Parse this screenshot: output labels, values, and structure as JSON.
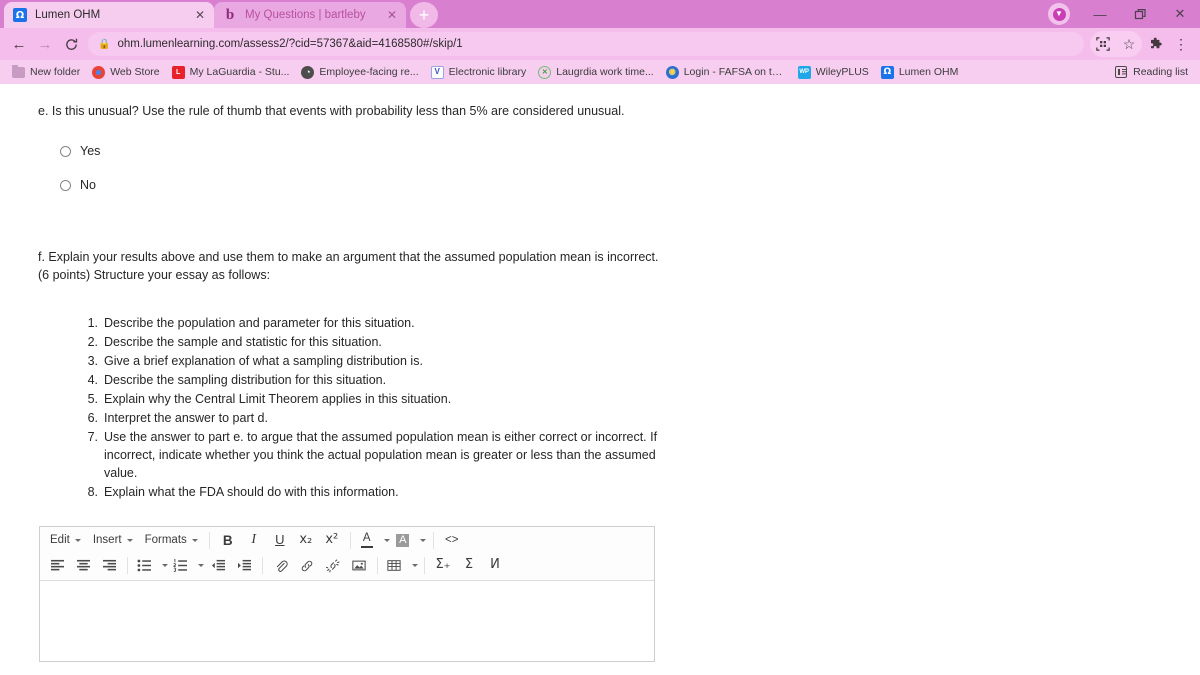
{
  "browser": {
    "tabs": [
      {
        "title": "Lumen OHM",
        "favicon": "omega-icon",
        "active": true,
        "close": "✕"
      },
      {
        "title": "My Questions | bartleby",
        "favicon": "bartleby-b-icon",
        "active": false,
        "close": "✕"
      }
    ],
    "new_tab_label": "+",
    "window_controls": {
      "minimize": "—",
      "maximize": "❐",
      "close": "✕"
    },
    "nav": {
      "back": "←",
      "forward": "→",
      "reload": "⟳"
    },
    "omnibox": {
      "lock": "🔒",
      "host": "ohm.lumenlearning.com",
      "path": "/assess2/?cid=57367&aid=4168580#/skip/1",
      "full_url": "ohm.lumenlearning.com/assess2/?cid=57367&aid=4168580#/skip/1"
    },
    "toolbar_icons": {
      "qr_share": "qr-code-icon",
      "bookmark_star": "☆",
      "extensions": "puzzle-icon",
      "menu": "⋮"
    },
    "bookmarks": [
      {
        "label": "New folder",
        "icon": "folder-icon"
      },
      {
        "label": "Web Store",
        "icon": "chrome-webstore-icon"
      },
      {
        "label": "My LaGuardia - Stu...",
        "icon": "laguardia-icon",
        "glyph": "L"
      },
      {
        "label": "Employee-facing re...",
        "icon": "globe-icon",
        "glyph": "◔"
      },
      {
        "label": "Electronic library",
        "icon": "library-icon",
        "glyph": "V"
      },
      {
        "label": "Laugrdia work time...",
        "icon": "green-circle-x-icon",
        "glyph": "✕"
      },
      {
        "label": "Login - FAFSA on th...",
        "icon": "fafsa-globe-icon",
        "glyph": "◉"
      },
      {
        "label": "WileyPLUS",
        "icon": "wileyplus-icon",
        "glyph": "WP"
      },
      {
        "label": "Lumen OHM",
        "icon": "omega-icon",
        "glyph": "Ω"
      }
    ],
    "reading_list": {
      "label": "Reading list",
      "icon": "reading-list-icon"
    }
  },
  "question": {
    "part_e": {
      "text": "e. Is this unusual? Use the rule of thumb that events with probability less than 5% are considered unusual.",
      "choices": [
        {
          "label": "Yes",
          "selected": false
        },
        {
          "label": "No",
          "selected": false
        }
      ]
    },
    "part_f": {
      "text": "f. Explain your results above and use them to make an argument that the assumed population mean is incorrect. (6 points) Structure your essay as follows:",
      "steps": [
        {
          "num": "1.",
          "text": "Describe the population and parameter for this situation."
        },
        {
          "num": "2.",
          "text": "Describe the sample and statistic for this situation."
        },
        {
          "num": "3.",
          "text": "Give a brief explanation of what a sampling distribution is."
        },
        {
          "num": "4.",
          "text": "Describe the sampling distribution for this situation."
        },
        {
          "num": "5.",
          "text": "Explain why the Central Limit Theorem applies in this situation."
        },
        {
          "num": "6.",
          "text": "Interpret the answer to part d."
        },
        {
          "num": "7.",
          "text": "Use the answer to part e. to argue that the assumed population mean is either correct or incorrect. If incorrect, indicate whether you think the actual population mean is greater or less than the assumed value."
        },
        {
          "num": "8.",
          "text": "Explain what the FDA should do with this information."
        }
      ]
    }
  },
  "editor": {
    "menus": [
      {
        "label": "Edit",
        "icon": "chevron-down-icon"
      },
      {
        "label": "Insert",
        "icon": "chevron-down-icon"
      },
      {
        "label": "Formats",
        "icon": "chevron-down-icon"
      }
    ],
    "format_buttons": [
      {
        "name": "bold",
        "glyph": "B"
      },
      {
        "name": "italic",
        "glyph": "I"
      },
      {
        "name": "underline",
        "glyph": "U"
      },
      {
        "name": "subscript",
        "glyph": "x₂"
      },
      {
        "name": "superscript",
        "glyph": "x²"
      }
    ],
    "color_buttons": [
      {
        "name": "text-color",
        "glyph": "A"
      },
      {
        "name": "background-color",
        "glyph": "A"
      }
    ],
    "source_code": {
      "name": "source-code",
      "glyph": "<>"
    },
    "align_buttons": [
      {
        "name": "align-left"
      },
      {
        "name": "align-center"
      },
      {
        "name": "align-right"
      }
    ],
    "list_buttons": [
      {
        "name": "bullet-list"
      },
      {
        "name": "numbered-list"
      }
    ],
    "indent_buttons": [
      {
        "name": "outdent"
      },
      {
        "name": "indent"
      }
    ],
    "insert_buttons": [
      {
        "name": "attachment"
      },
      {
        "name": "insert-link"
      },
      {
        "name": "unlink"
      },
      {
        "name": "insert-image"
      },
      {
        "name": "insert-table"
      }
    ],
    "math_buttons": [
      {
        "name": "insert-equation",
        "glyph": "Σ₊"
      },
      {
        "name": "math-symbol",
        "glyph": "Σ"
      },
      {
        "name": "special-character",
        "glyph": "Ͷ"
      }
    ],
    "body_value": "",
    "body_placeholder": ""
  },
  "colors": {
    "tabstrip_bg": "#d97fd0",
    "toolbar_bg": "#f5bdec",
    "bookmarks_bg": "#f7cdf0",
    "active_tab_bg": "#f6cdee",
    "inactive_tab_bg": "#e9a8e2",
    "page_bg": "#ffffff",
    "text": "#262626",
    "editor_border": "#cfcfcf"
  }
}
